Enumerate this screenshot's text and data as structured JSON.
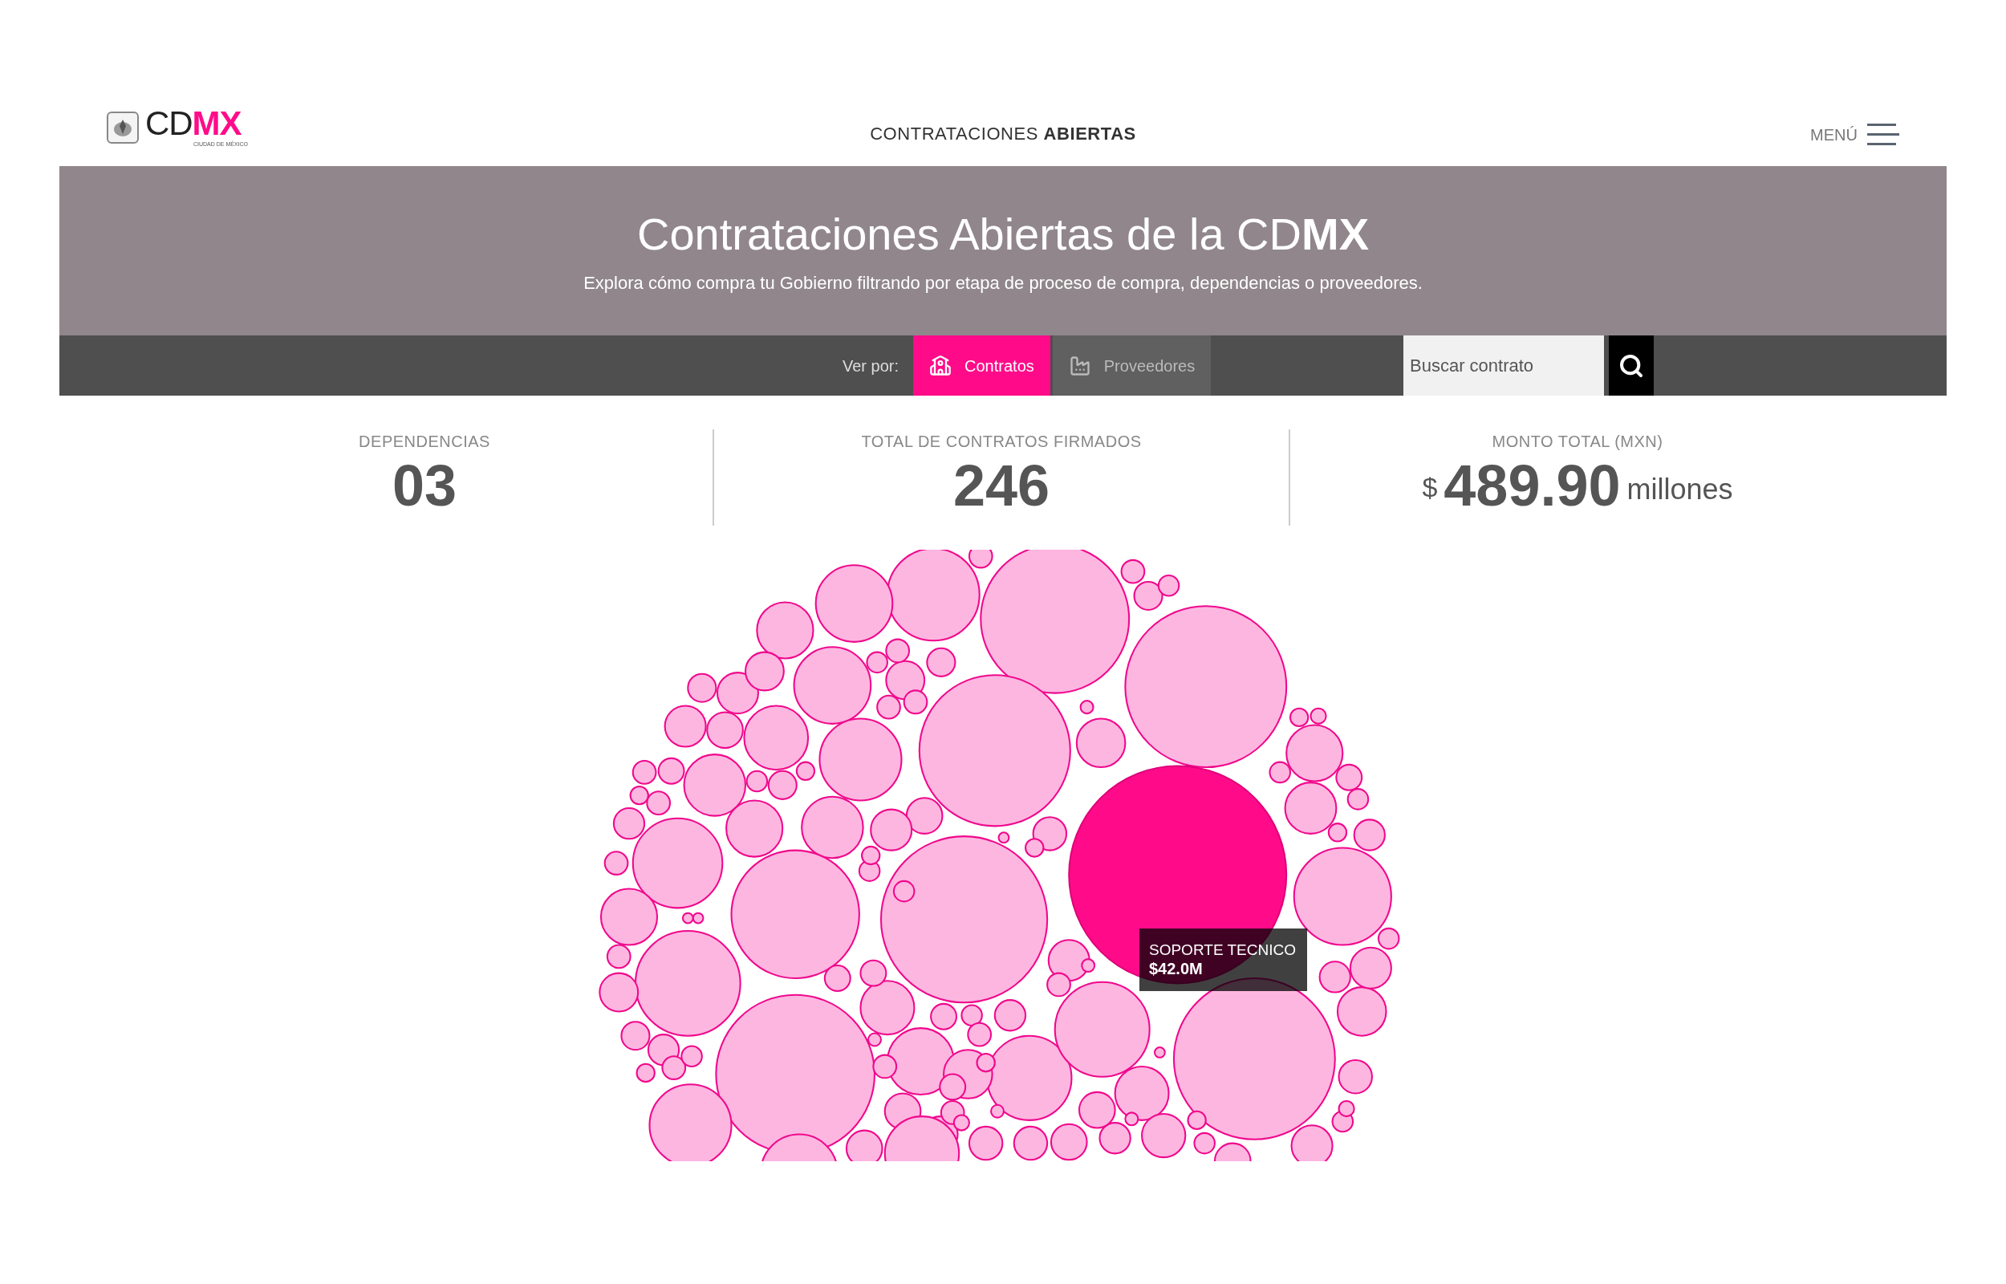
{
  "header": {
    "logo": {
      "text_regular": "CD",
      "text_accent": "MX",
      "subtitle": "CIUDAD DE MÉXICO"
    },
    "title": "CONTRATACIONES **ABIERTAS**",
    "menu": "MENÚ"
  },
  "banner": {
    "title": "Contrataciones Abiertas de la CD**MX**",
    "subtitle": "Explora cómo compra tu Gobierno filtrando por etapa de proceso de compra, dependencias o proveedores."
  },
  "toolbar": {
    "label": "Ver por:",
    "tabs": [
      {
        "label": "Contratos",
        "kind": "building",
        "selected": true
      },
      {
        "label": "Proveedores",
        "kind": "factory",
        "selected": false
      }
    ],
    "search": {
      "placeholder": "Buscar contrato"
    }
  },
  "stats": [
    {
      "label": "DEPENDENCIAS",
      "value": "03"
    },
    {
      "label": "TOTAL DE CONTRATOS FIRMADOS",
      "value": "246"
    },
    {
      "label": "MONTO TOTAL (MXN)",
      "prefix": "$",
      "value": "489.90",
      "suffix": "millones"
    }
  ],
  "tooltip": {
    "label": "SOPORTE TECNICO",
    "amount": "$42.0M"
  }
}
